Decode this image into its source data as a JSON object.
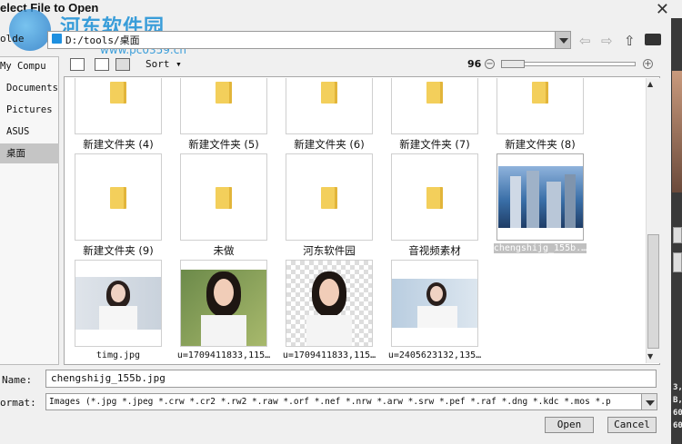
{
  "title": "elect File to Open",
  "watermark": {
    "text": "河东软件园",
    "url": "www.pc0359.cn"
  },
  "path": {
    "label": "olde",
    "value": "D:/tools/桌面"
  },
  "sidebar": [
    {
      "label": "My Compu"
    },
    {
      "label": "Documents"
    },
    {
      "label": "Pictures"
    },
    {
      "label": "ASUS"
    },
    {
      "label": "桌面"
    }
  ],
  "toolbar": {
    "sort_label": "Sort",
    "zoom_value": "96"
  },
  "files": [
    {
      "name": "新建文件夹 (4)",
      "kind": "folder"
    },
    {
      "name": "新建文件夹 (5)",
      "kind": "folder"
    },
    {
      "name": "新建文件夹 (6)",
      "kind": "folder"
    },
    {
      "name": "新建文件夹 (7)",
      "kind": "folder"
    },
    {
      "name": "新建文件夹 (8)",
      "kind": "folder"
    },
    {
      "name": "新建文件夹 (9)",
      "kind": "folder"
    },
    {
      "name": "未做",
      "kind": "folder"
    },
    {
      "name": "河东软件园",
      "kind": "folder"
    },
    {
      "name": "音视频素材",
      "kind": "folder"
    },
    {
      "name": "chengshijg_155b.…",
      "kind": "image-buildings"
    },
    {
      "name": "timg.jpg",
      "kind": "image-portrait"
    },
    {
      "name": "u=1709411833,115…",
      "kind": "image-portrait-green"
    },
    {
      "name": "u=1709411833,115…",
      "kind": "image-portrait-checker"
    },
    {
      "name": "u=2405623132,135…",
      "kind": "image-portrait-blue"
    }
  ],
  "name_field": {
    "label": "Name:",
    "value": "chengshijg_155b.jpg"
  },
  "format_field": {
    "label": "ormat:",
    "value": "Images (*.jpg *.jpeg *.crw *.cr2 *.rw2 *.raw *.orf *.nef *.nrw *.arw *.srw *.pef *.raf *.dng *.kdc *.mos *.p"
  },
  "buttons": {
    "open": "Open",
    "cancel": "Cancel"
  },
  "right_edge_text": [
    "3,",
    "B,",
    "60",
    "60"
  ]
}
